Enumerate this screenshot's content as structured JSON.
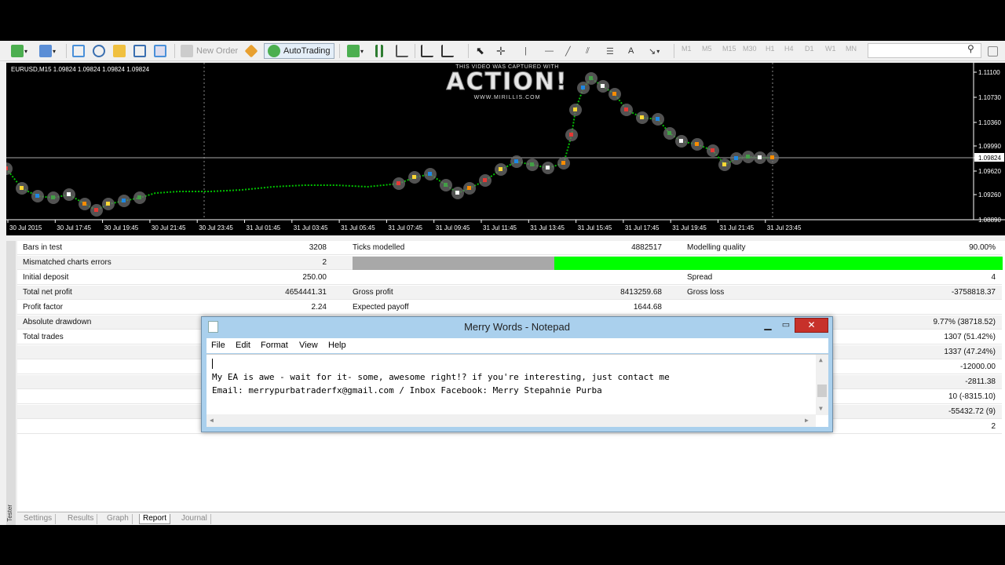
{
  "toolbar": {
    "new_order_label": "New Order",
    "autotrading_label": "AutoTrading",
    "timeframes": [
      "M1",
      "M5",
      "M15",
      "M30",
      "H1",
      "H4",
      "D1",
      "W1",
      "MN"
    ]
  },
  "chart": {
    "symbol_info": "EURUSD,M15  1.09824 1.09824 1.09824 1.09824",
    "watermark": {
      "top": "THIS VIDEO WAS CAPTURED WITH",
      "brand": "ACTION!",
      "url": "WWW.MIRILLIS.COM"
    },
    "price_labels": [
      "1.11100",
      "1.10730",
      "1.10360",
      "1.09990",
      "1.09824",
      "1.09620",
      "1.09260",
      "1.08890"
    ],
    "time_labels": [
      "30 Jul 2015",
      "30 Jul 17:45",
      "30 Jul 19:45",
      "30 Jul 21:45",
      "30 Jul 23:45",
      "31 Jul 01:45",
      "31 Jul 03:45",
      "31 Jul 05:45",
      "31 Jul 07:45",
      "31 Jul 09:45",
      "31 Jul 11:45",
      "31 Jul 13:45",
      "31 Jul 15:45",
      "31 Jul 17:45",
      "31 Jul 19:45",
      "31 Jul 21:45",
      "31 Jul 23:45"
    ],
    "current_price": "1.09824",
    "colors": {
      "bg": "#000000",
      "line": "#00c000",
      "grid": "#c0c0c0"
    }
  },
  "report": {
    "rows": [
      {
        "a_label": "Bars in test",
        "a_value": "3208",
        "b_label": "Ticks modelled",
        "b_value": "4882517",
        "c_label": "Modelling quality",
        "c_value": "90.00%"
      },
      {
        "a_label": "Mismatched charts errors",
        "a_value": "2",
        "b_label": "",
        "b_value": "",
        "c_label": "",
        "c_value": ""
      },
      {
        "a_label": "Initial deposit",
        "a_value": "250.00",
        "b_label": "",
        "b_value": "",
        "c_label": "Spread",
        "c_value": "4"
      },
      {
        "a_label": "Total net profit",
        "a_value": "4654441.31",
        "b_label": "Gross profit",
        "b_value": "8413259.68",
        "c_label": "Gross loss",
        "c_value": "-3758818.37"
      },
      {
        "a_label": "Profit factor",
        "a_value": "2.24",
        "b_label": "Expected payoff",
        "b_value": "1644.68",
        "c_label": "",
        "c_value": ""
      },
      {
        "a_label": "Absolute drawdown",
        "a_value": "",
        "b_label": "",
        "b_value": "",
        "c_label": "",
        "c_value": "9.77% (38718.52)"
      },
      {
        "a_label": "Total trades",
        "a_value": "",
        "b_label": "",
        "b_value": "",
        "c_label": "",
        "c_value": "1307 (51.42%)"
      },
      {
        "a_label": "",
        "a_value": "",
        "b_label": "",
        "b_value": "",
        "c_label": "",
        "c_value": "1337 (47.24%)"
      },
      {
        "a_label": "",
        "a_value": "",
        "b_label": "",
        "b_value": "",
        "c_label": "",
        "c_value": "-12000.00"
      },
      {
        "a_label": "",
        "a_value": "",
        "b_label": "",
        "b_value": "",
        "c_label": "",
        "c_value": "-2811.38"
      },
      {
        "a_label": "",
        "a_value": "",
        "b_label": "",
        "b_value": "",
        "c_label": "",
        "c_value": "10 (-8315.10)"
      },
      {
        "a_label": "",
        "a_value": "",
        "b_label": "",
        "b_value": "",
        "c_label": "",
        "c_value": "-55432.72 (9)"
      },
      {
        "a_label": "",
        "a_value": "",
        "b_label": "",
        "b_value": "",
        "c_label": "",
        "c_value": "2"
      }
    ],
    "modelling_quality_progress": 0.9,
    "mismatch_fraction": 0.31,
    "sidebar_label": "Tester"
  },
  "tabs": [
    "Settings",
    "Results",
    "Graph",
    "Report",
    "Journal"
  ],
  "active_tab": "Report",
  "notepad": {
    "title": "Merry Words - Notepad",
    "menu": [
      "File",
      "Edit",
      "Format",
      "View",
      "Help"
    ],
    "lines": [
      "My EA is awe - wait for it- some, awesome right!? if you're interesting, just contact me",
      "Email: merrypurbatraderfx@gmail.com / Inbox Facebook: Merry Stepahnie Purba"
    ],
    "close_label": "✕"
  }
}
